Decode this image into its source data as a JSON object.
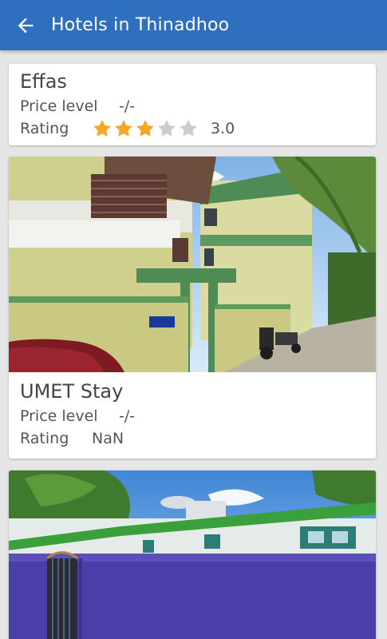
{
  "appbar": {
    "back_icon": "arrow-left-icon",
    "title": "Hotels in Thinadhoo"
  },
  "hotels": [
    {
      "name": "Effas",
      "price_label": "Price level",
      "price_value": "-/-",
      "rating_label": "Rating",
      "rating_value": "3.0",
      "stars_filled": 3,
      "stars_total": 5
    },
    {
      "name": "UMET Stay",
      "price_label": "Price level",
      "price_value": "-/-",
      "rating_label": "Rating",
      "rating_value": "NaN"
    },
    {
      "name": ""
    }
  ],
  "colors": {
    "primary": "#2f6fc0",
    "star_filled": "#f5a623",
    "star_empty": "#cccccc"
  }
}
